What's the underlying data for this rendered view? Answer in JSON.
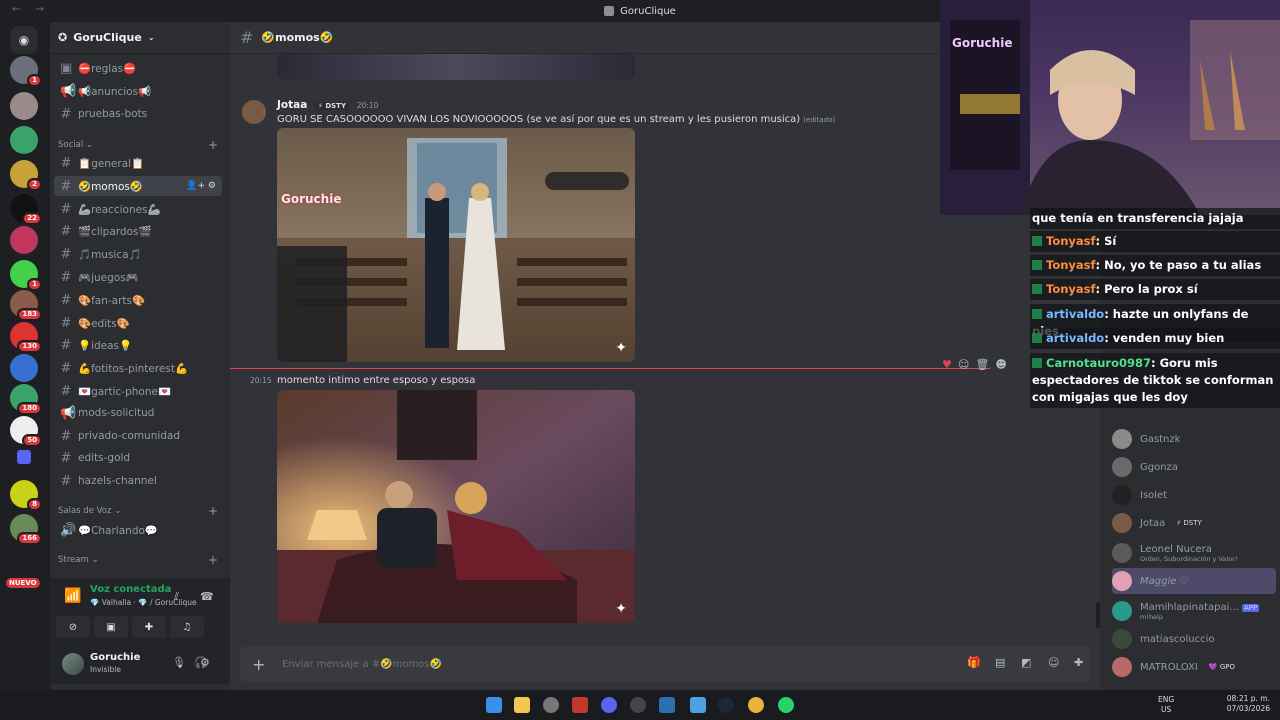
{
  "window": {
    "title": "GoruClique"
  },
  "server": {
    "name": "GoruClique"
  },
  "rail_badges": [
    "1",
    "2",
    "22",
    "1",
    "183",
    "130",
    "180",
    "50",
    "8",
    "166"
  ],
  "rail_new_label": "NUEVO",
  "channels_top": [
    {
      "name": "⛔reglas⛔",
      "icon": "rules-icon"
    },
    {
      "name": "📢anuncios📢",
      "icon": "megaphone-icon"
    },
    {
      "name": "pruebas-bots",
      "icon": "hash-icon"
    }
  ],
  "categories": {
    "social": "Social",
    "voice": "Salas de Voz",
    "stream": "Stream"
  },
  "channels_social": [
    {
      "name": "📋general📋"
    },
    {
      "name": "🤣momos🤣",
      "active": true
    },
    {
      "name": "🦾reacciones🦾"
    },
    {
      "name": "🎬clipardos🎬"
    },
    {
      "name": "🎵musica🎵"
    },
    {
      "name": "🎮juegos🎮"
    },
    {
      "name": "🎨fan-arts🎨"
    },
    {
      "name": "🎨edits🎨"
    },
    {
      "name": "💡ideas💡"
    },
    {
      "name": "💪fotitos-pinterest💪"
    },
    {
      "name": "💌gartic-phone💌"
    },
    {
      "name": "mods-solicitud"
    },
    {
      "name": "privado-comunidad"
    },
    {
      "name": "edits-gold"
    },
    {
      "name": "hazels-channel"
    }
  ],
  "voice_channel": "💬Charlando💬",
  "voice_status": {
    "title": "Voz conectada",
    "subtitle": "💎 Valhalla · 💎 / GoruClique"
  },
  "user": {
    "name": "Goruchie",
    "status": "Invisible"
  },
  "chat": {
    "channel": "🤣momos🤣",
    "message1": {
      "author": "Jotaa",
      "tag": "⚡ DSTY",
      "time": "20:10",
      "text": "GORU SE CASOOOOOO VIVAN LOS NOVIOOOOOS (se ve así por que es un stream y les pusieron musica)",
      "edited": "(editado)",
      "image_label": "Goruchie"
    },
    "message2": {
      "time": "20:15",
      "text": "momento intimo entre esposo y esposa"
    },
    "input_placeholder": "Enviar mensaje a #🤣momos🤣"
  },
  "stream_chat": [
    {
      "user": "",
      "text": "que tenía en transferencia jajaja"
    },
    {
      "user": "Tonyasf",
      "text": ": Sí"
    },
    {
      "user": "Tonyasf",
      "text": ": No, yo te paso a tu alias"
    },
    {
      "user": "Tonyasf",
      "text": ": Pero la prox sí"
    },
    {
      "user": "artivaldo",
      "text": ": hazte un onlyfans de pies"
    },
    {
      "user": "artivaldo",
      "text": ": venden muy bien"
    },
    {
      "user": "Carnotauro0987",
      "text": ": Goru mis espectadores de tiktok se conforman con migajas que les doy"
    }
  ],
  "members": [
    {
      "name": "Gastnzk"
    },
    {
      "name": "Ggonza"
    },
    {
      "name": "Isolet"
    },
    {
      "name": "Jotaa",
      "tag": "⚡ DSTY"
    },
    {
      "name": "Leonel Nucera",
      "sub": "Orden, Subordinación y Valor!"
    },
    {
      "name": "Maggie ♡"
    },
    {
      "name": "Mamihlapinatapai...",
      "tag": "APP",
      "sub": "m!help"
    },
    {
      "name": "matiascoluccio"
    },
    {
      "name": "MATROLOXI",
      "tag": "💜 GPO"
    }
  ],
  "webcam_label": "Goruchie",
  "taskbar": {
    "lang1": "ENG",
    "lang2": "US",
    "time": "08:21 p. m.",
    "date": "07/03/2026"
  }
}
